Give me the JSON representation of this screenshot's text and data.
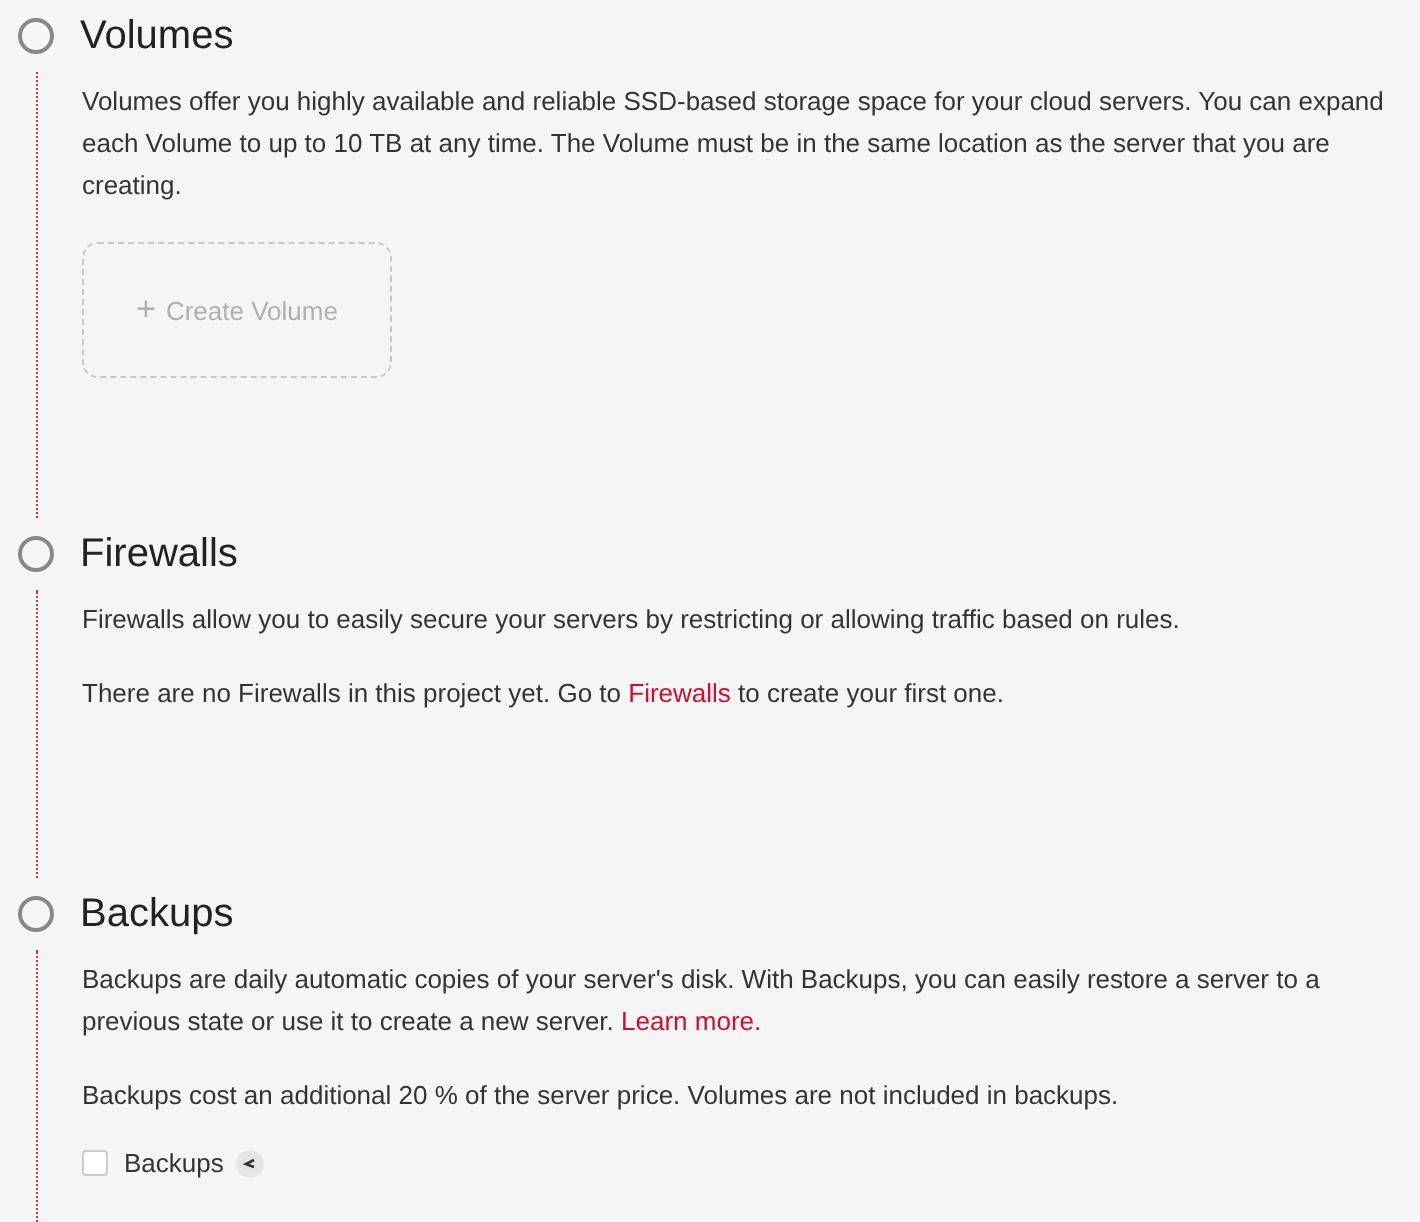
{
  "sections": [
    {
      "title": "Volumes",
      "paragraphs": [
        [
          {
            "text": "Volumes offer you highly available and reliable SSD-based storage space for your cloud servers. You can expand each Volume to up to 10 TB at any time. The Volume must be in the same location as the server that you are creating."
          }
        ]
      ],
      "create_button": {
        "icon": "+",
        "label": "Create Volume"
      }
    },
    {
      "title": "Firewalls",
      "paragraphs": [
        [
          {
            "text": "Firewalls allow you to easily secure your servers by restricting or allowing traffic based on rules."
          }
        ],
        [
          {
            "text": "There are no Firewalls in this project yet. Go to "
          },
          {
            "link": "Firewalls"
          },
          {
            "text": " to create your first one."
          }
        ]
      ]
    },
    {
      "title": "Backups",
      "paragraphs": [
        [
          {
            "text": "Backups are daily automatic copies of your server's disk. With Backups, you can easily restore a server to a previous state or use it to create a new server. "
          },
          {
            "link": "Learn more."
          }
        ],
        [
          {
            "text": "Backups cost an additional 20 % of the server price. Volumes are not included in backups."
          }
        ]
      ],
      "checkbox": {
        "label": "Backups",
        "checked": false
      }
    }
  ]
}
